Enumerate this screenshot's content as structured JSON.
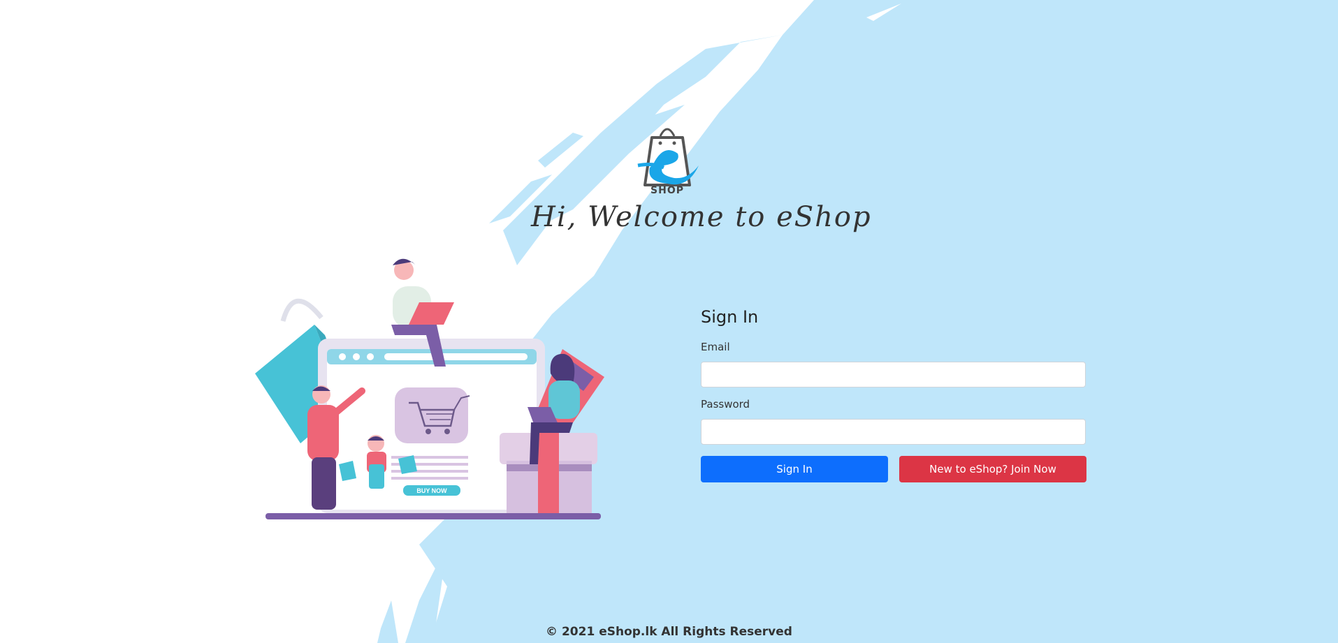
{
  "brand": {
    "logo_text": "SHOP",
    "welcome": "Hi, Welcome to eShop",
    "colors": {
      "accent": "#1aa6e8",
      "background_splash": "#bfe6fa"
    }
  },
  "illustration": {
    "icon": "online-shopping-illustration",
    "buy_now": "BUY NOW"
  },
  "signin": {
    "title": "Sign In",
    "email_label": "Email",
    "email_value": "",
    "email_placeholder": "",
    "password_label": "Password",
    "password_value": "",
    "password_placeholder": "",
    "signin_button": "Sign In",
    "join_button": "New to eShop? Join Now",
    "colors": {
      "primary": "#0d6efd",
      "danger": "#dc3545"
    }
  },
  "footer": {
    "text": "© 2021 eShop.lk All Rights Reserved"
  }
}
